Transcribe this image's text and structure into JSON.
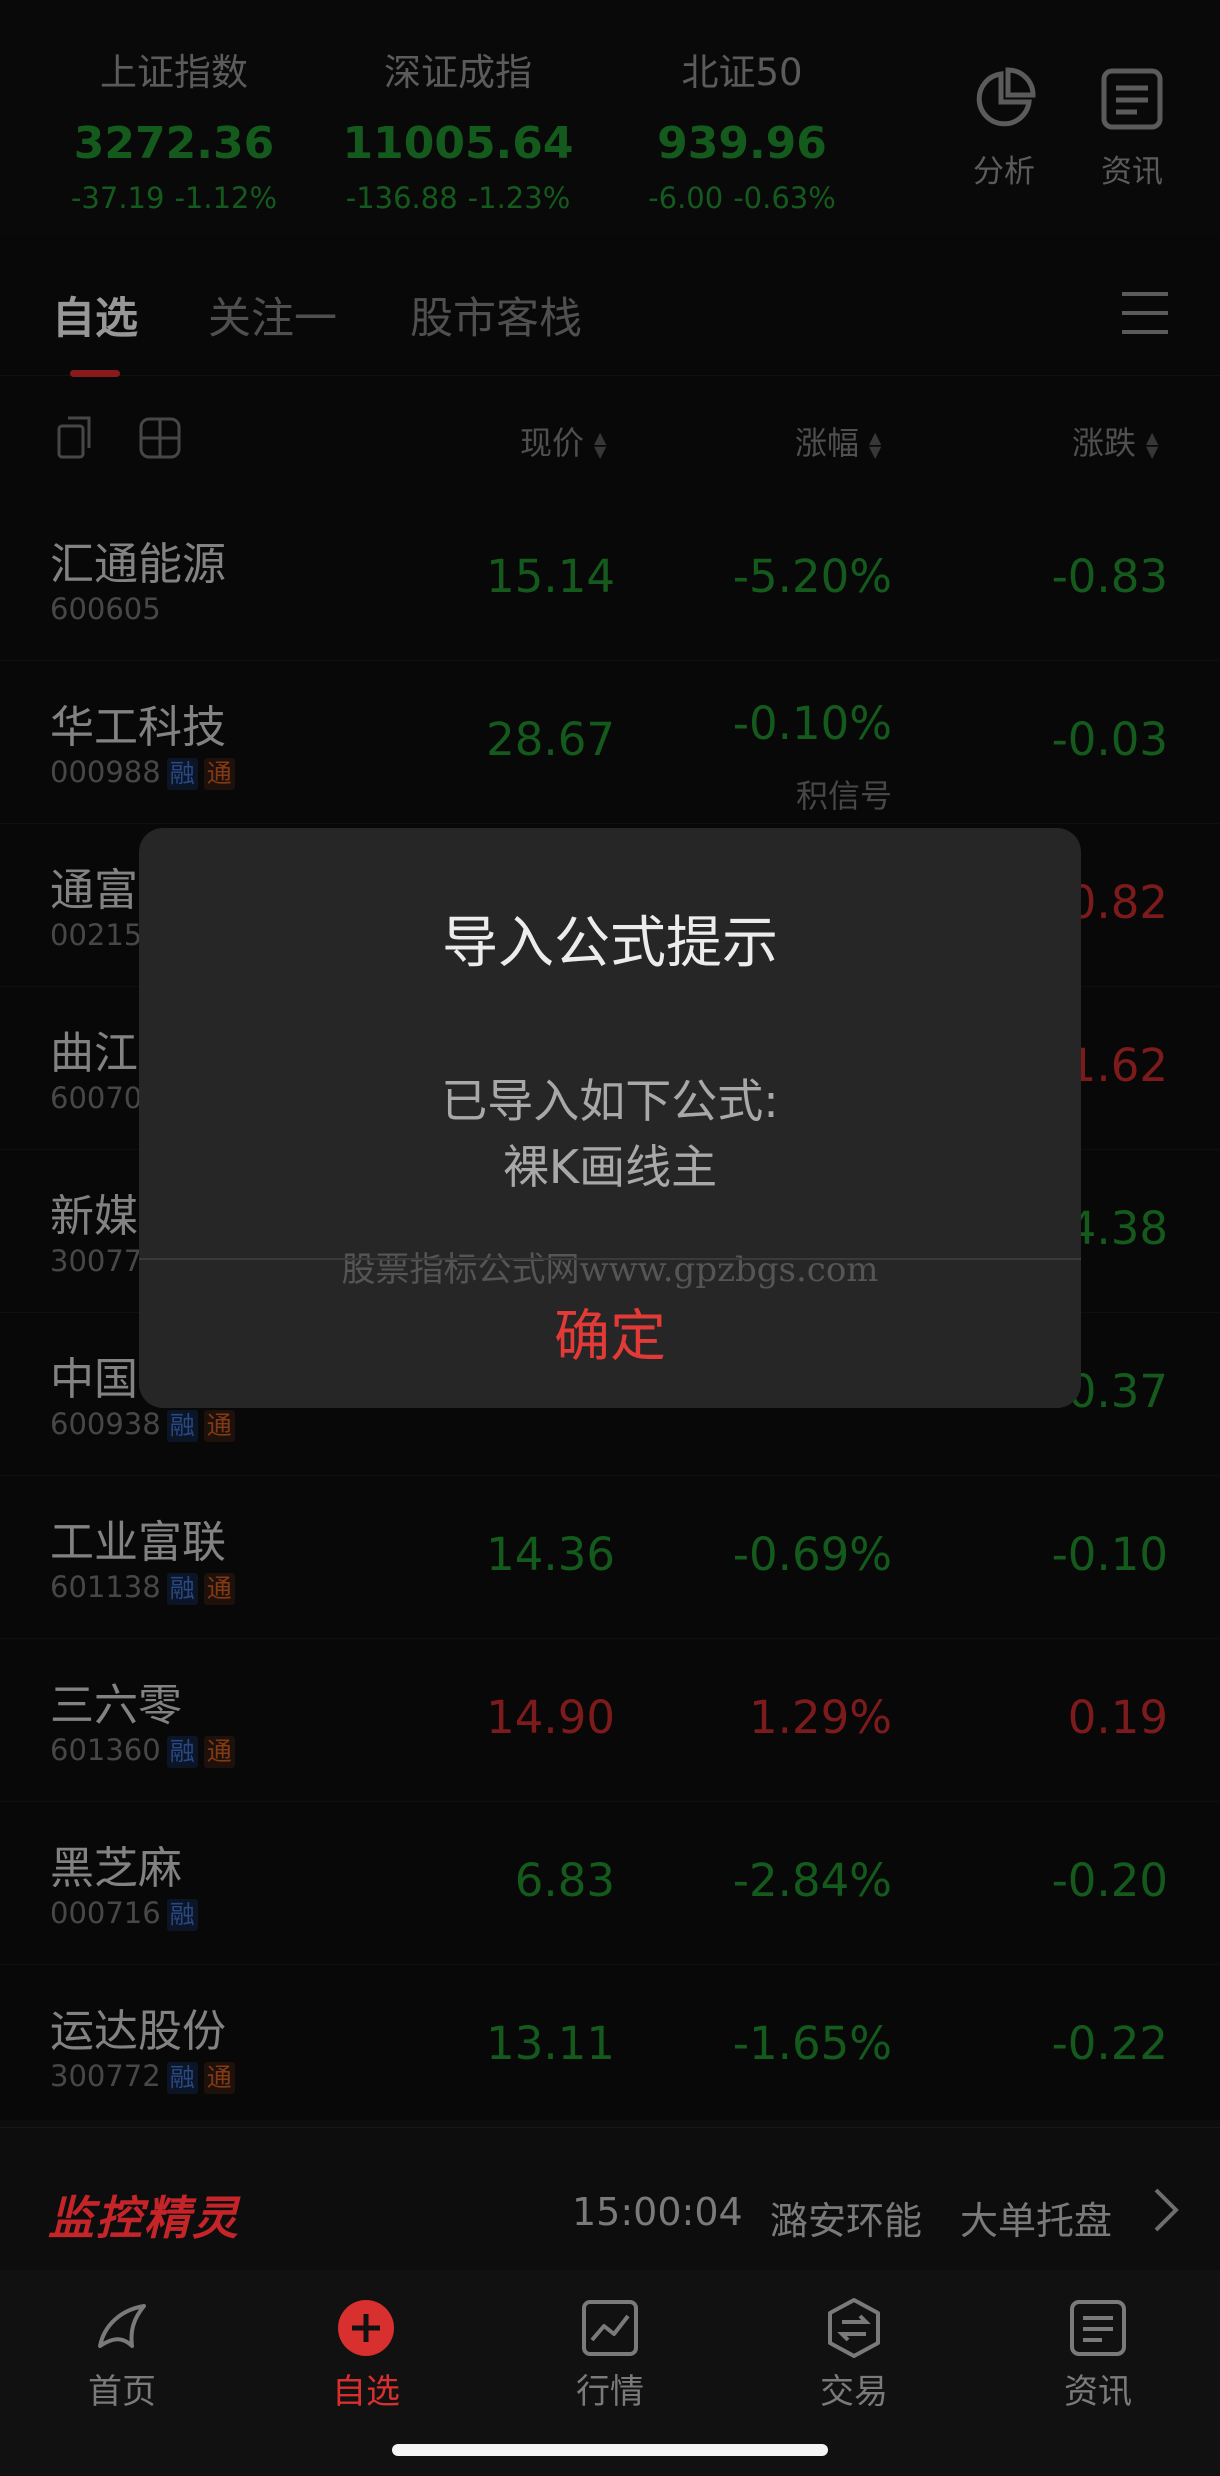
{
  "indices": [
    {
      "name": "上证指数",
      "value": "3272.36",
      "change": "-37.19",
      "pct": "-1.12%"
    },
    {
      "name": "深证成指",
      "value": "11005.64",
      "change": "-136.88",
      "pct": "-1.23%"
    },
    {
      "name": "北证50",
      "value": "939.96",
      "change": "-6.00",
      "pct": "-0.63%"
    }
  ],
  "top_buttons": {
    "analysis": "分析",
    "news": "资讯"
  },
  "tabs": [
    "自选",
    "关注一",
    "股市客栈"
  ],
  "columns": {
    "price": "现价",
    "pct": "涨幅",
    "change": "涨跌"
  },
  "rows": [
    {
      "name": "汇通能源",
      "code": "600605",
      "price": "15.14",
      "pct": "-5.20%",
      "change": "-0.83",
      "color": "green"
    },
    {
      "name": "华工科技",
      "code": "000988",
      "price": "28.67",
      "pct": "-0.10%",
      "change": "-0.03",
      "color": "green",
      "sub": "积信号",
      "badges": [
        "融",
        "通"
      ]
    },
    {
      "name": "通富",
      "code": "00215",
      "change": "0.82",
      "color": "red"
    },
    {
      "name": "曲江",
      "code": "60070",
      "change": "1.62",
      "color": "red"
    },
    {
      "name": "新媒",
      "code": "30077",
      "change": "4.38",
      "color": "green"
    },
    {
      "name": "中国",
      "code": "600938",
      "change": "0.37",
      "color": "green",
      "badges": [
        "融",
        "通"
      ]
    },
    {
      "name": "工业富联",
      "code": "601138",
      "price": "14.36",
      "pct": "-0.69%",
      "change": "-0.10",
      "color": "green",
      "badges": [
        "融",
        "通"
      ]
    },
    {
      "name": "三六零",
      "code": "601360",
      "price": "14.90",
      "pct": "1.29%",
      "change": "0.19",
      "color": "red",
      "badges": [
        "融",
        "通"
      ]
    },
    {
      "name": "黑芝麻",
      "code": "000716",
      "price": "6.83",
      "pct": "-2.84%",
      "change": "-0.20",
      "color": "green",
      "badges": [
        "融"
      ]
    },
    {
      "name": "运达股份",
      "code": "300772",
      "price": "13.11",
      "pct": "-1.65%",
      "change": "-0.22",
      "color": "green",
      "badges": [
        "融",
        "通"
      ]
    }
  ],
  "dialog": {
    "title": "导入公式提示",
    "message_line1": "已导入如下公式:",
    "message_line2": "裸K画线主",
    "watermark": "股票指标公式网www.gpzbgs.com",
    "ok": "确定"
  },
  "ticker": {
    "logo": "监控精灵",
    "time": "15:00:04",
    "stock": "潞安环能",
    "type": "大单托盘"
  },
  "nav": [
    "首页",
    "自选",
    "行情",
    "交易",
    "资讯"
  ],
  "colors": {
    "up": "#c0282a",
    "down": "#1f8b2c",
    "accent": "#d1292c"
  }
}
